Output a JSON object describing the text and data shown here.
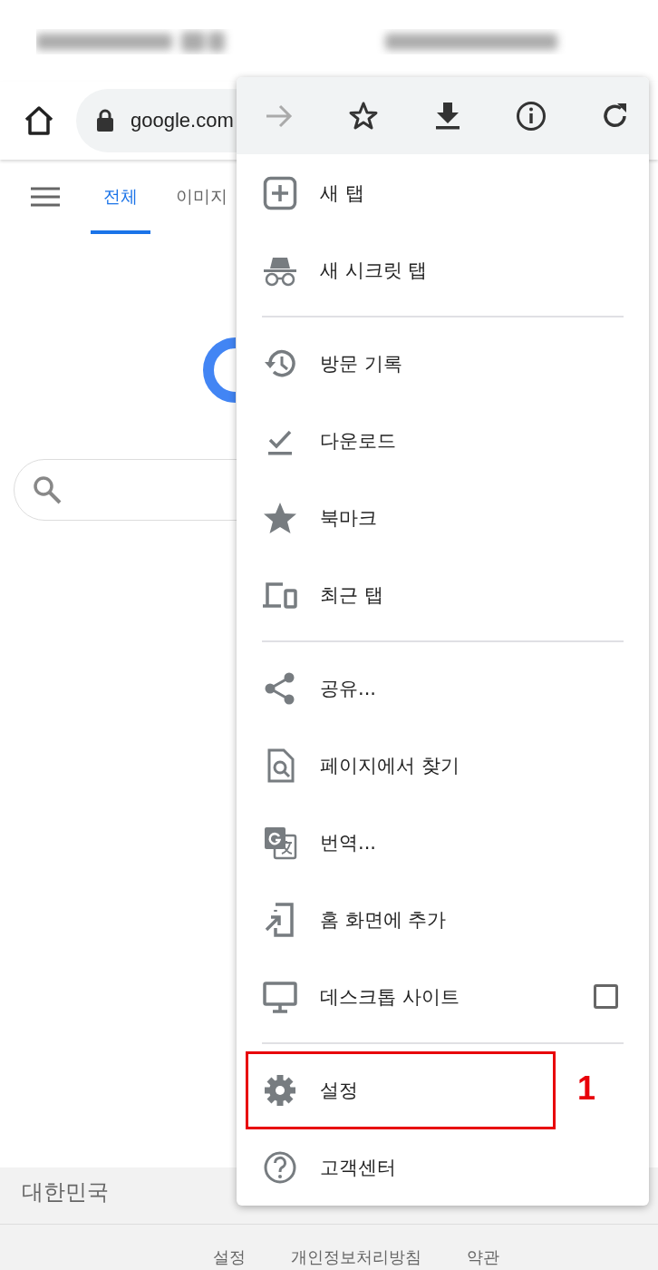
{
  "toolbar": {
    "url": "google.com"
  },
  "tabs": [
    {
      "label": "전체",
      "selected": true
    },
    {
      "label": "이미지",
      "selected": false
    }
  ],
  "menu": {
    "actions": [
      {
        "disabled": true
      },
      {
        "disabled": false
      },
      {
        "disabled": false
      },
      {
        "disabled": false
      },
      {
        "disabled": false
      }
    ],
    "sections": [
      [
        {
          "label": "새 탭",
          "kind": "plain"
        },
        {
          "label": "새 시크릿 탭",
          "kind": "plain"
        }
      ],
      [
        {
          "label": "방문 기록",
          "kind": "plain"
        },
        {
          "label": "다운로드",
          "kind": "plain"
        },
        {
          "label": "북마크",
          "kind": "plain"
        },
        {
          "label": "최근 탭",
          "kind": "plain"
        }
      ],
      [
        {
          "label": "공유...",
          "kind": "plain"
        },
        {
          "label": "페이지에서 찾기",
          "kind": "plain"
        },
        {
          "label": "번역...",
          "kind": "plain"
        },
        {
          "label": "홈 화면에 추가",
          "kind": "plain"
        },
        {
          "label": "데스크톱 사이트",
          "kind": "checkbox",
          "checked": false
        }
      ],
      [
        {
          "label": "설정",
          "kind": "plain",
          "highlighted": true
        },
        {
          "label": "고객센터",
          "kind": "plain",
          "highlighted": false
        }
      ]
    ]
  },
  "annotation": {
    "label": "1"
  },
  "footer": {
    "country": "대한민국",
    "links": [
      "설정",
      "개인정보처리방침",
      "약관"
    ]
  }
}
